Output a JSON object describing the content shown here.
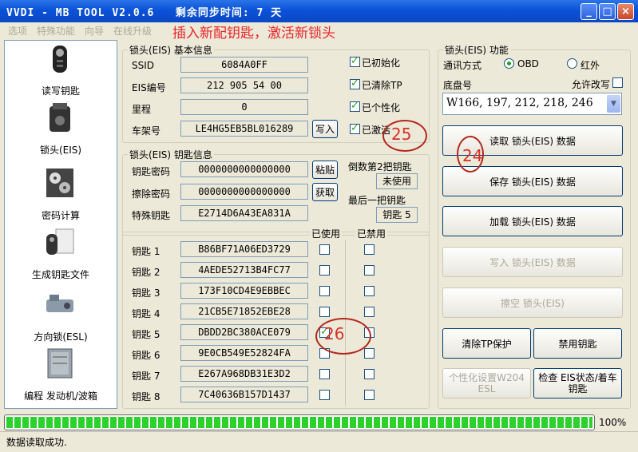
{
  "title": "VVDI - MB TOOL V2.0.6   剩余同步时间: 7 天",
  "window": {
    "min": "_",
    "max": "□",
    "close": "×"
  },
  "menu": [
    "选项",
    "特殊功能",
    "向导",
    "在线升级"
  ],
  "banner": "插入新配钥匙，激活新锁头",
  "sidebar": [
    {
      "label": "读写钥匙",
      "icon": "key-fob-icon"
    },
    {
      "label": "锁头(EIS)",
      "icon": "eis-ignition-icon"
    },
    {
      "label": "密码计算",
      "icon": "gears-icon"
    },
    {
      "label": "生成钥匙文件",
      "icon": "key-file-icon"
    },
    {
      "label": "方向锁(ESL)",
      "icon": "steering-lock-icon"
    },
    {
      "label": "编程 发动机/波箱",
      "icon": "ecu-icon"
    }
  ],
  "basic": {
    "legend": "锁头(EIS) 基本信息",
    "ssid_label": "SSID",
    "ssid": "6084A0FF",
    "eis_label": "EIS编号",
    "eis": "212 905 54 00",
    "mileage_label": "里程",
    "mileage": "0",
    "vin_label": "车架号",
    "vin": "LE4HG5EB5BL016289",
    "write_btn": "写入",
    "checks": [
      {
        "label": "已初始化",
        "checked": true
      },
      {
        "label": "已清除TP",
        "checked": true
      },
      {
        "label": "已个性化",
        "checked": true
      },
      {
        "label": "已激活",
        "checked": true
      }
    ]
  },
  "keyinfo": {
    "legend": "锁头(EIS) 钥匙信息",
    "pwd_label": "钥匙密码",
    "pwd": "0000000000000000",
    "paste_btn": "粘贴",
    "erase_label": "擦除密码",
    "erase": "0000000000000000",
    "get_btn": "获取",
    "special_label": "特殊钥匙",
    "special": "E2714D6A43EA831A",
    "second_last_label": "倒数第2把钥匙",
    "second_last": "未使用",
    "last_label": "最后一把钥匙",
    "last": "钥匙 5"
  },
  "keys": {
    "used_header": "已使用",
    "disabled_header": "已禁用",
    "rows": [
      {
        "label": "钥匙 1",
        "hash": "B86BF71A06ED3729",
        "used": false,
        "disabled": false
      },
      {
        "label": "钥匙 2",
        "hash": "4AEDE52713B4FC77",
        "used": false,
        "disabled": false
      },
      {
        "label": "钥匙 3",
        "hash": "173F10CD4E9EBBEC",
        "used": false,
        "disabled": false
      },
      {
        "label": "钥匙 4",
        "hash": "21CB5E71852EBE28",
        "used": false,
        "disabled": false
      },
      {
        "label": "钥匙 5",
        "hash": "DBDD2BC380ACE079",
        "used": true,
        "disabled": false
      },
      {
        "label": "钥匙 6",
        "hash": "9E0CB549E52824FA",
        "used": false,
        "disabled": false
      },
      {
        "label": "钥匙 7",
        "hash": "E267A968DB31E3D2",
        "used": false,
        "disabled": false
      },
      {
        "label": "钥匙 8",
        "hash": "7C40636B157D1437",
        "used": false,
        "disabled": false
      }
    ]
  },
  "func": {
    "legend": "锁头(EIS) 功能",
    "comm_label": "通讯方式",
    "obd": "OBD",
    "ir": "红外",
    "chassis_label": "底盘号",
    "allow_modify": "允许改写",
    "chassis_value": "W166, 197, 212, 218, 246",
    "read_btn": "读取 锁头(EIS) 数据",
    "save_btn": "保存 锁头(EIS) 数据",
    "load_btn": "加载 锁头(EIS) 数据",
    "write_btn": "写入 锁头(EIS) 数据",
    "erase_btn": "擦空 锁头(EIS)",
    "clear_tp_btn": "清除TP保护",
    "disable_key_btn": "禁用钥匙",
    "personalize_btn": "个性化设置W204 ESL",
    "check_btn": "检查 EIS状态/着车钥匙"
  },
  "annotations": [
    "25",
    "24",
    "26"
  ],
  "progress": {
    "percent": 100,
    "text": "100%"
  },
  "status": "数据读取成功."
}
